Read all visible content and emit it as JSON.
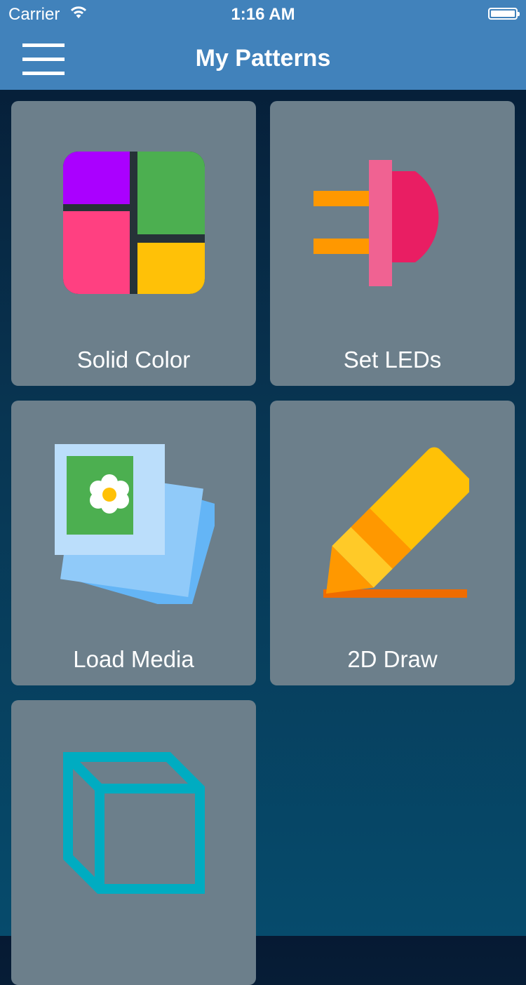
{
  "status": {
    "carrier": "Carrier",
    "time": "1:16 AM"
  },
  "nav": {
    "title": "My Patterns",
    "menu_icon": "hamburger-menu-icon"
  },
  "tiles": [
    {
      "label": "Solid Color",
      "icon": "color-grid-icon"
    },
    {
      "label": "Set LEDs",
      "icon": "led-icon"
    },
    {
      "label": "Load Media",
      "icon": "photos-icon"
    },
    {
      "label": "2D Draw",
      "icon": "pencil-icon"
    },
    {
      "label": "",
      "icon": "cube-icon"
    }
  ],
  "colors": {
    "bar": "#4182bb",
    "tile": "#6c7f8b",
    "background_top": "#061a33",
    "background_bottom": "#064b6c"
  }
}
